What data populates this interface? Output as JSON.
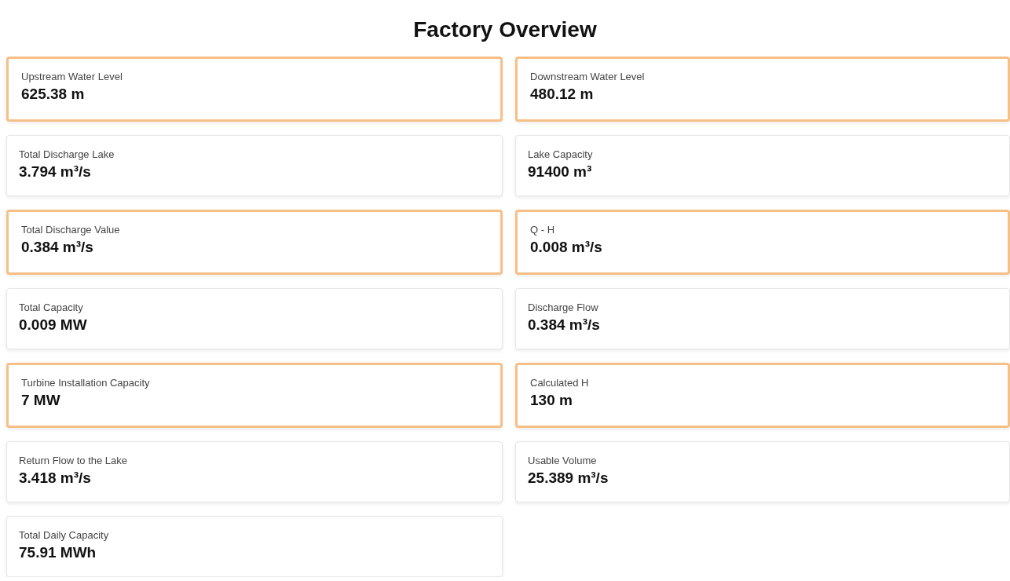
{
  "title": "Factory Overview",
  "cards": [
    {
      "label": "Upstream Water Level",
      "value": "625.38 m",
      "highlighted": true
    },
    {
      "label": "Downstream Water Level",
      "value": "480.12 m",
      "highlighted": true
    },
    {
      "label": "Total Discharge Lake",
      "value": "3.794 m³/s",
      "highlighted": false
    },
    {
      "label": "Lake Capacity",
      "value": "91400 m³",
      "highlighted": false
    },
    {
      "label": "Total Discharge Value",
      "value": "0.384 m³/s",
      "highlighted": true
    },
    {
      "label": "Q - H",
      "value": "0.008 m³/s",
      "highlighted": true
    },
    {
      "label": "Total Capacity",
      "value": "0.009 MW",
      "highlighted": false
    },
    {
      "label": "Discharge Flow",
      "value": "0.384 m³/s",
      "highlighted": false
    },
    {
      "label": "Turbine Installation Capacity",
      "value": "7 MW",
      "highlighted": true
    },
    {
      "label": "Calculated H",
      "value": "130 m",
      "highlighted": true
    },
    {
      "label": "Return Flow to the Lake",
      "value": "3.418 m³/s",
      "highlighted": false
    },
    {
      "label": "Usable Volume",
      "value": "25.389 m³/s",
      "highlighted": false
    },
    {
      "label": "Total Daily Capacity",
      "value": "75.91 MWh",
      "highlighted": false
    }
  ]
}
